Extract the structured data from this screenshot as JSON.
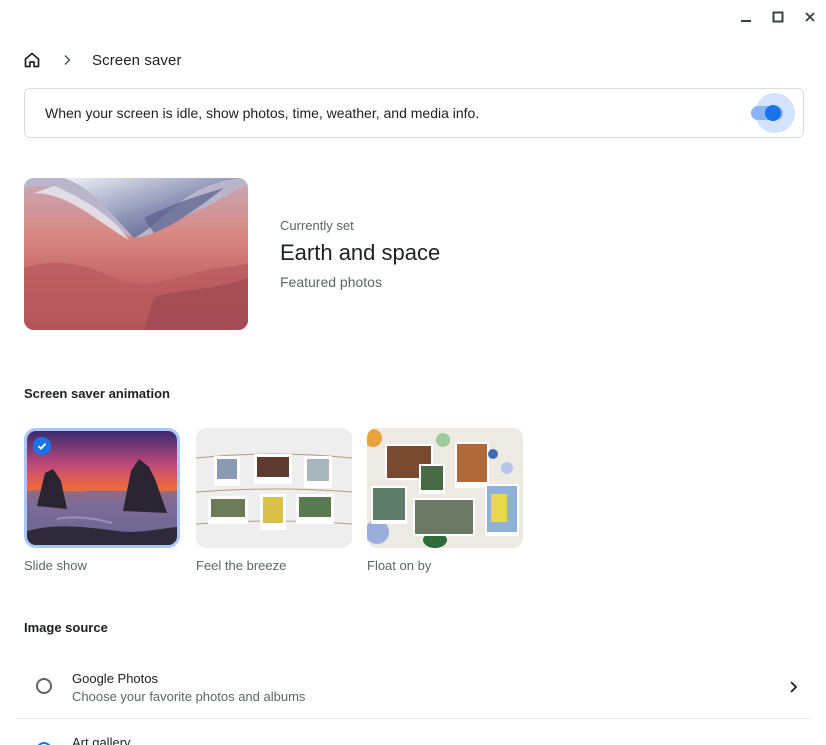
{
  "window": {
    "minimize_icon": "minimize-icon",
    "maximize_icon": "maximize-icon",
    "close_icon": "close-icon"
  },
  "breadcrumb": {
    "home_icon": "home-icon",
    "separator_icon": "chevron-right-icon",
    "title": "Screen saver"
  },
  "toggle_card": {
    "text": "When your screen is idle, show photos, time, weather, and media info.",
    "enabled": true
  },
  "current": {
    "label": "Currently set",
    "title": "Earth and space",
    "subtitle": "Featured photos"
  },
  "animation": {
    "heading": "Screen saver animation",
    "options": [
      {
        "label": "Slide show",
        "selected": true
      },
      {
        "label": "Feel the breeze",
        "selected": false
      },
      {
        "label": "Float on by",
        "selected": false
      }
    ]
  },
  "image_source": {
    "heading": "Image source",
    "items": [
      {
        "title": "Google Photos",
        "subtitle": "Choose your favorite photos and albums",
        "selected": false
      },
      {
        "title": "Art gallery",
        "subtitle": "",
        "selected": true
      }
    ]
  },
  "colors": {
    "accent": "#1a73e8",
    "accent_light": "#8ab4f8",
    "halo": "#d3e3fd",
    "border": "#dadce0"
  }
}
